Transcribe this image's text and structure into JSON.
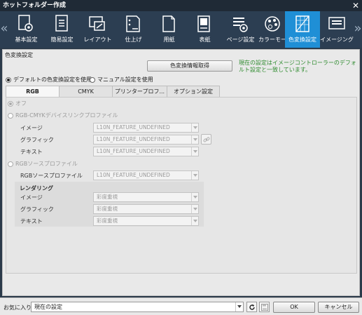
{
  "window": {
    "title": "ホットフォルダー作成"
  },
  "toolbar": {
    "items": [
      {
        "label": "基本設定",
        "icon": "basic-settings-icon"
      },
      {
        "label": "簡易設定",
        "icon": "simple-settings-icon"
      },
      {
        "label": "レイアウト",
        "icon": "layout-icon"
      },
      {
        "label": "仕上げ",
        "icon": "finishing-icon"
      },
      {
        "label": "用紙",
        "icon": "paper-icon"
      },
      {
        "label": "表紙",
        "icon": "cover-icon"
      },
      {
        "label": "ページ設定",
        "icon": "page-settings-icon"
      },
      {
        "label": "カラーモード",
        "icon": "color-mode-icon"
      },
      {
        "label": "色変換設定",
        "icon": "color-conversion-icon"
      },
      {
        "label": "イメージング",
        "icon": "imaging-icon"
      }
    ],
    "active_index": 8
  },
  "panel": {
    "section_title": "色変換設定",
    "get_button": "色変換情報取得",
    "status_message": "現在の設定はイメージコントローラーのデフォルト設定と一致しています。",
    "mode_default": "デフォルトの色変換設定を使用",
    "mode_manual": "マニュアル設定を使用",
    "tabs": [
      "RGB",
      "CMYK",
      "プリンタープロフ...",
      "オプション設定"
    ],
    "active_tab": 0,
    "rgb": {
      "off_label": "オフ",
      "devicelink_label": "RGB-CMYKデバイスリンクプロファイル",
      "devicelink_rows": [
        {
          "label": "イメージ",
          "value": "L10N_FEATURE_UNDEFINED"
        },
        {
          "label": "グラフィック",
          "value": "L10N_FEATURE_UNDEFINED"
        },
        {
          "label": "テキスト",
          "value": "L10N_FEATURE_UNDEFINED"
        }
      ],
      "source_label": "RGBソースプロファイル",
      "source_row": {
        "label": "RGBソースプロファイル",
        "value": "L10N_FEATURE_UNDEFINED"
      },
      "rendering_label": "レンダリング",
      "rendering_rows": [
        {
          "label": "イメージ",
          "value": "彩度重視"
        },
        {
          "label": "グラフィック",
          "value": "彩度重視"
        },
        {
          "label": "テキスト",
          "value": "彩度重視"
        }
      ]
    }
  },
  "footer": {
    "favorites_label": "お気に入り",
    "favorites_value": "現在の設定",
    "ok": "OK",
    "cancel": "キャンセル"
  },
  "colors": {
    "accent": "#1f8fd6",
    "status_text": "#2e8b2e",
    "toolbar_bg": "#2c3e52"
  }
}
